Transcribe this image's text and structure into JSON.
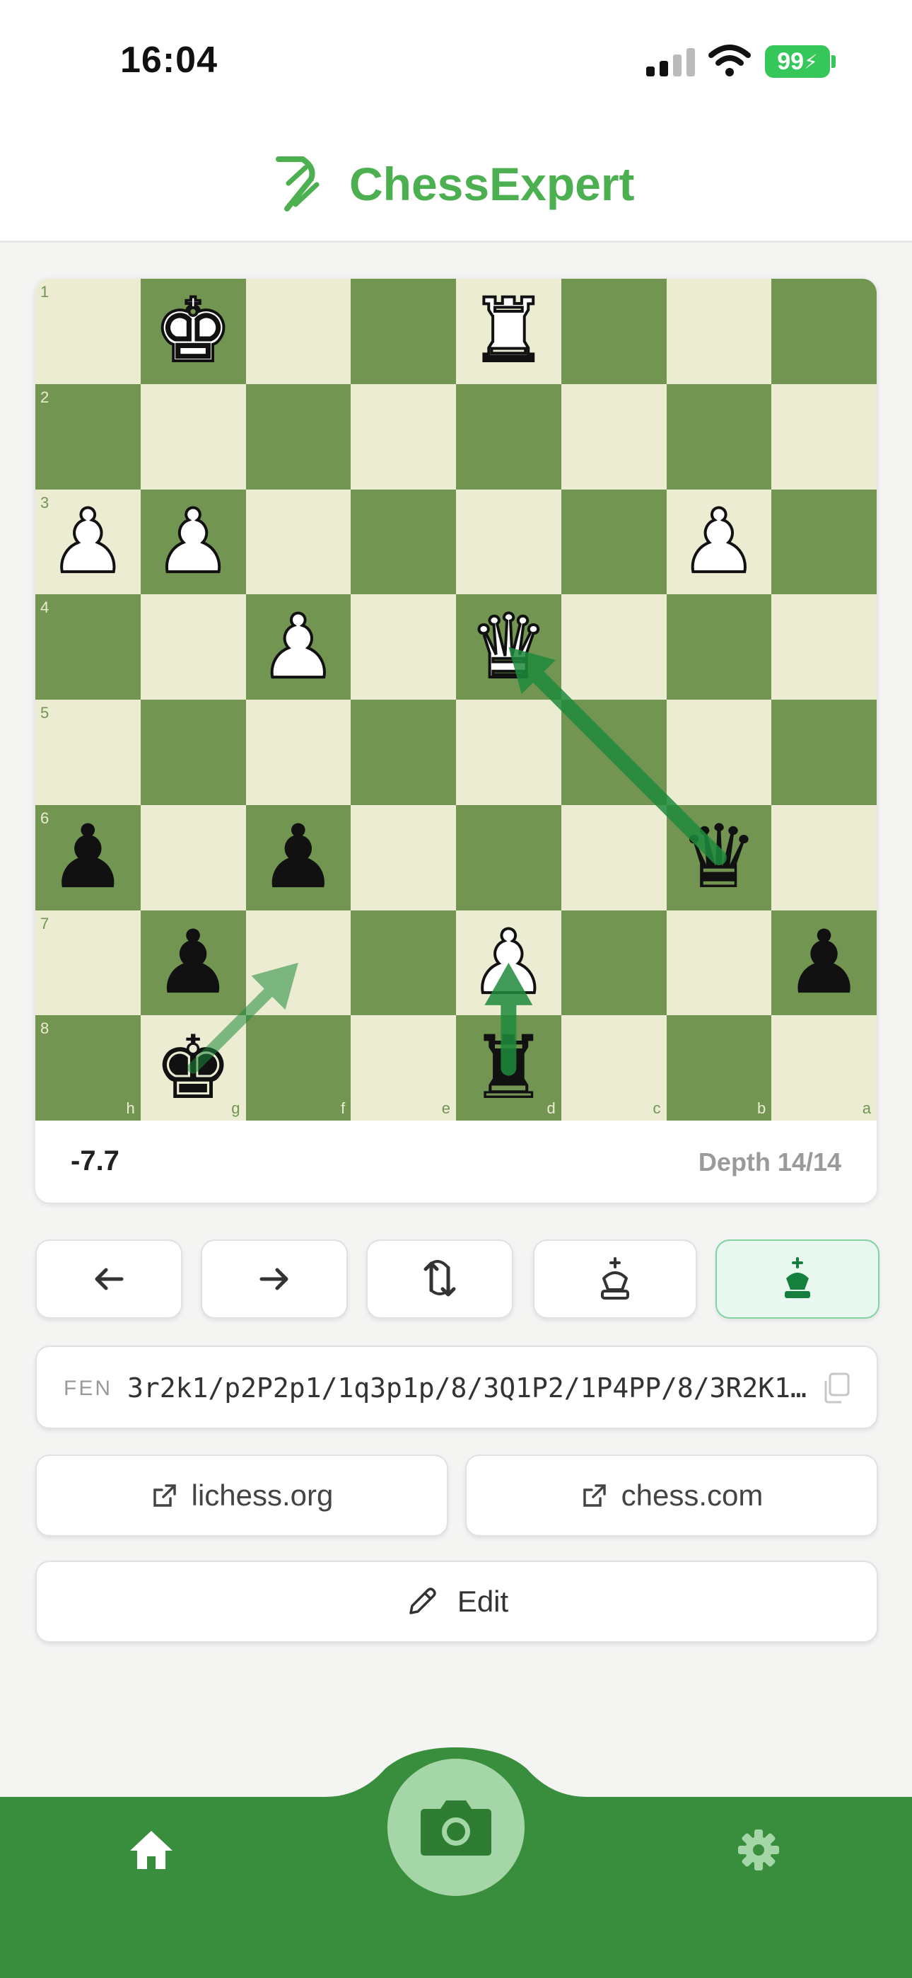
{
  "status_bar": {
    "time": "16:04",
    "battery": "99"
  },
  "header": {
    "title": "ChessExpert"
  },
  "board": {
    "rank_labels": [
      "1",
      "2",
      "3",
      "4",
      "5",
      "6",
      "7",
      "8"
    ],
    "file_labels": [
      "h",
      "g",
      "f",
      "e",
      "d",
      "c",
      "b",
      "a"
    ],
    "pieces": [
      {
        "square": "g1",
        "piece": "K",
        "color": "white",
        "name": "white-king"
      },
      {
        "square": "d1",
        "piece": "R",
        "color": "white",
        "name": "white-rook"
      },
      {
        "square": "h3",
        "piece": "P",
        "color": "white",
        "name": "white-pawn"
      },
      {
        "square": "g3",
        "piece": "P",
        "color": "white",
        "name": "white-pawn"
      },
      {
        "square": "b3",
        "piece": "P",
        "color": "white",
        "name": "white-pawn"
      },
      {
        "square": "f4",
        "piece": "P",
        "color": "white",
        "name": "white-pawn"
      },
      {
        "square": "d4",
        "piece": "Q",
        "color": "white",
        "name": "white-queen"
      },
      {
        "square": "h6",
        "piece": "P",
        "color": "black",
        "name": "black-pawn"
      },
      {
        "square": "f6",
        "piece": "P",
        "color": "black",
        "name": "black-pawn"
      },
      {
        "square": "b6",
        "piece": "Q",
        "color": "black",
        "name": "black-queen"
      },
      {
        "square": "g7",
        "piece": "P",
        "color": "black",
        "name": "black-pawn"
      },
      {
        "square": "d7",
        "piece": "P",
        "color": "white",
        "name": "white-pawn"
      },
      {
        "square": "a7",
        "piece": "P",
        "color": "black",
        "name": "black-pawn"
      },
      {
        "square": "g8",
        "piece": "K",
        "color": "black",
        "name": "black-king"
      },
      {
        "square": "d8",
        "piece": "R",
        "color": "black",
        "name": "black-rook"
      }
    ],
    "arrows": [
      {
        "from": "b6",
        "to": "d4",
        "strength": "primary"
      },
      {
        "from": "d8",
        "to": "d7",
        "strength": "primary"
      },
      {
        "from": "g8",
        "to": "f7",
        "strength": "secondary"
      }
    ],
    "light_color": "#ececd3",
    "dark_color": "#739552",
    "arrow_color": "#1f8a3c"
  },
  "evaluation": {
    "score": "-7.7",
    "depth": "Depth 14/14"
  },
  "controls": [
    "arrow-left-icon",
    "arrow-right-icon",
    "flip-board-icon",
    "white-king-icon",
    "black-king-icon"
  ],
  "fen": {
    "label": "FEN",
    "value": "3r2k1/p2P2p1/1q3p1p/8/3Q1P2/1P4PP/8/3R2K1…"
  },
  "links": {
    "lichess": "lichess.org",
    "chesscom": "chess.com"
  },
  "edit": {
    "label": "Edit"
  },
  "nav": {
    "items": [
      "home-icon",
      "camera-icon",
      "settings-icon"
    ],
    "accent": "#388e3c"
  }
}
